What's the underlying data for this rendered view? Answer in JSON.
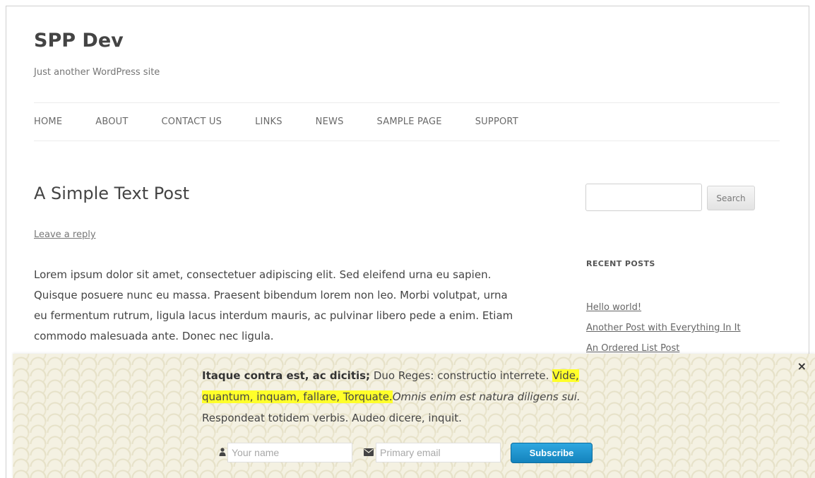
{
  "site": {
    "title": "SPP Dev",
    "tagline": "Just another WordPress site"
  },
  "nav": {
    "items": [
      {
        "label": "HOME"
      },
      {
        "label": "ABOUT"
      },
      {
        "label": "CONTACT US"
      },
      {
        "label": "LINKS"
      },
      {
        "label": "NEWS"
      },
      {
        "label": "SAMPLE PAGE"
      },
      {
        "label": "SUPPORT"
      }
    ]
  },
  "post": {
    "title": "A Simple Text Post",
    "reply_link": "Leave a reply",
    "body": "Lorem ipsum dolor sit amet, consectetuer adipiscing elit. Sed eleifend urna eu sapien. Quisque posuere nunc eu massa. Praesent bibendum lorem non leo. Morbi volutpat, urna eu fermentum rutrum, ligula lacus interdum mauris, ac pulvinar libero pede a enim. Etiam commodo malesuada ante. Donec nec ligula."
  },
  "sidebar": {
    "search_input_value": "",
    "search_button": "Search",
    "recent_posts_title": "RECENT POSTS",
    "recent_posts": [
      {
        "label": "Hello world!"
      },
      {
        "label": "Another Post with Everything In It"
      },
      {
        "label": "An Ordered List Post"
      }
    ]
  },
  "optin": {
    "close_glyph": "×",
    "text_bold": "Itaque contra est, ac dicitis;",
    "text_normal_1": " Duo Reges: constructio interrete. ",
    "text_highlight": "Vide, quantum, inquam, fallare, Torquate.",
    "text_italic": "Omnis enim est natura diligens sui.",
    "text_normal_2": " Respondeat totidem verbis. Audeo dicere, inquit.",
    "name_placeholder": "Your name",
    "email_placeholder": "Primary email",
    "subscribe_label": "Subscribe",
    "icons": {
      "name": "user-icon",
      "email": "envelope-icon",
      "close": "close-icon"
    },
    "colors": {
      "highlight": "#ffff2a",
      "button": "#1e95d1",
      "background": "#f4f1e2"
    }
  }
}
